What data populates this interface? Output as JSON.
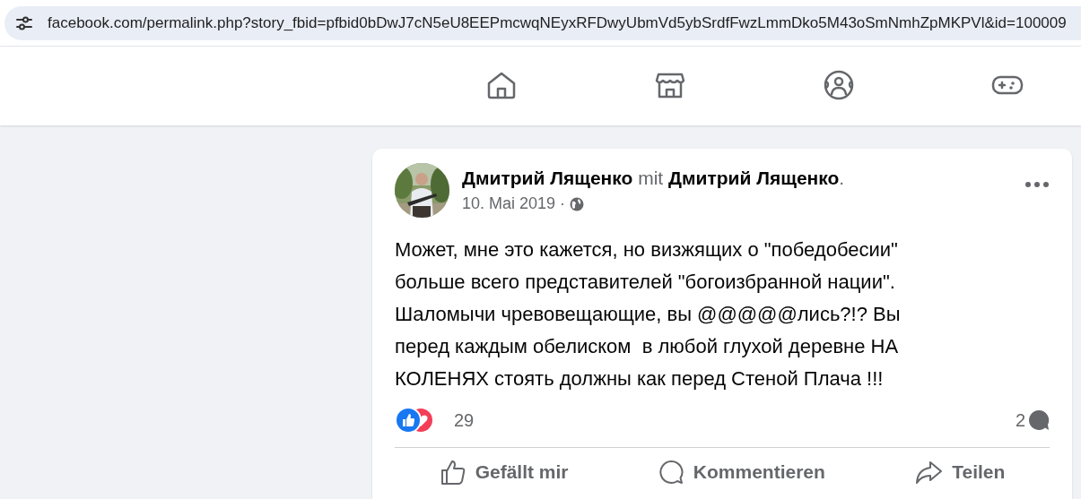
{
  "address_bar": {
    "url": "facebook.com/permalink.php?story_fbid=pfbid0bDwJ7cN5eU8EEPmcwqNEyxRFDwyUbmVd5ybSrdfFwzLmmDko5M43oSmNmhZpMKPVl&id=100009"
  },
  "nav": [
    {
      "kind": "home",
      "selected": false
    },
    {
      "kind": "marketplace",
      "selected": false
    },
    {
      "kind": "groups",
      "selected": false
    },
    {
      "kind": "gaming",
      "selected": false
    }
  ],
  "post": {
    "author": "Дмитрий Лященко",
    "connector": "mit",
    "tagged": "Дмитрий Лященко",
    "end": ".",
    "date": "10. Mai 2019 ·",
    "text": "Может, мне это кажется, но визжящих о \"победобесии\"\nбольше всего представителей \"богоизбранной нации\".\nШаломычи чревовещающие, вы @@@@@лись?!? Вы\nперед каждым обелиском  в любой глухой деревне НА\nКОЛЕНЯХ стоять должны как перед Стеной Плача !!!",
    "reaction_count": "29",
    "comment_count": "2",
    "actions": [
      {
        "kind": "like",
        "label": "Gefällt mir"
      },
      {
        "kind": "comment",
        "label": "Kommentieren"
      },
      {
        "kind": "share",
        "label": "Teilen"
      }
    ]
  }
}
